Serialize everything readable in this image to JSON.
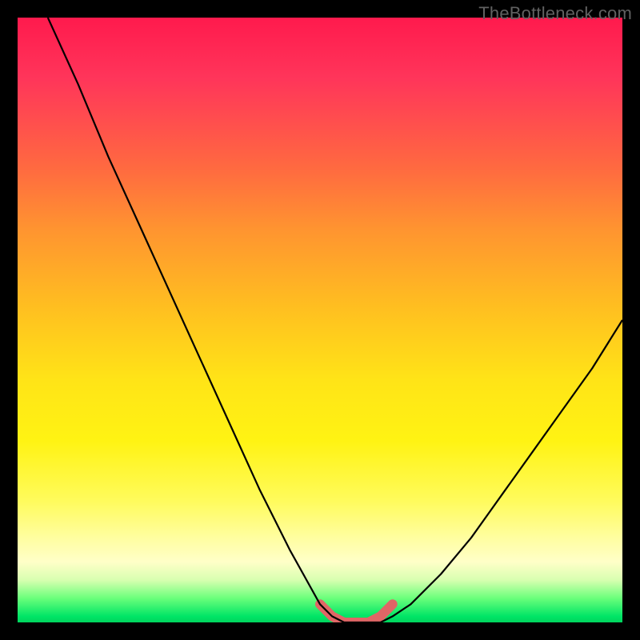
{
  "watermark": "TheBottleneck.com",
  "chart_data": {
    "type": "line",
    "title": "",
    "xlabel": "",
    "ylabel": "",
    "xlim": [
      0,
      100
    ],
    "ylim": [
      0,
      100
    ],
    "series": [
      {
        "name": "bottleneck-curve",
        "x": [
          5,
          10,
          15,
          20,
          25,
          30,
          35,
          40,
          45,
          50,
          52,
          54,
          56,
          58,
          60,
          62,
          65,
          70,
          75,
          80,
          85,
          90,
          95,
          100
        ],
        "y": [
          100,
          89,
          77,
          66,
          55,
          44,
          33,
          22,
          12,
          3,
          1,
          0,
          0,
          0,
          0,
          1,
          3,
          8,
          14,
          21,
          28,
          35,
          42,
          50
        ]
      }
    ],
    "highlight_segment": {
      "name": "optimal-range",
      "x": [
        50,
        52,
        54,
        56,
        58,
        60,
        62
      ],
      "y": [
        3,
        1,
        0,
        0,
        0,
        1,
        3
      ],
      "color": "#e06666",
      "stroke_width": 12
    },
    "background_gradient": {
      "stops": [
        {
          "pos": 0.0,
          "color": "#ff1a4d"
        },
        {
          "pos": 0.25,
          "color": "#ff6a40"
        },
        {
          "pos": 0.5,
          "color": "#ffbf20"
        },
        {
          "pos": 0.7,
          "color": "#fff313"
        },
        {
          "pos": 0.9,
          "color": "#ffffc8"
        },
        {
          "pos": 0.96,
          "color": "#6bff7b"
        },
        {
          "pos": 1.0,
          "color": "#00d45d"
        }
      ]
    }
  }
}
